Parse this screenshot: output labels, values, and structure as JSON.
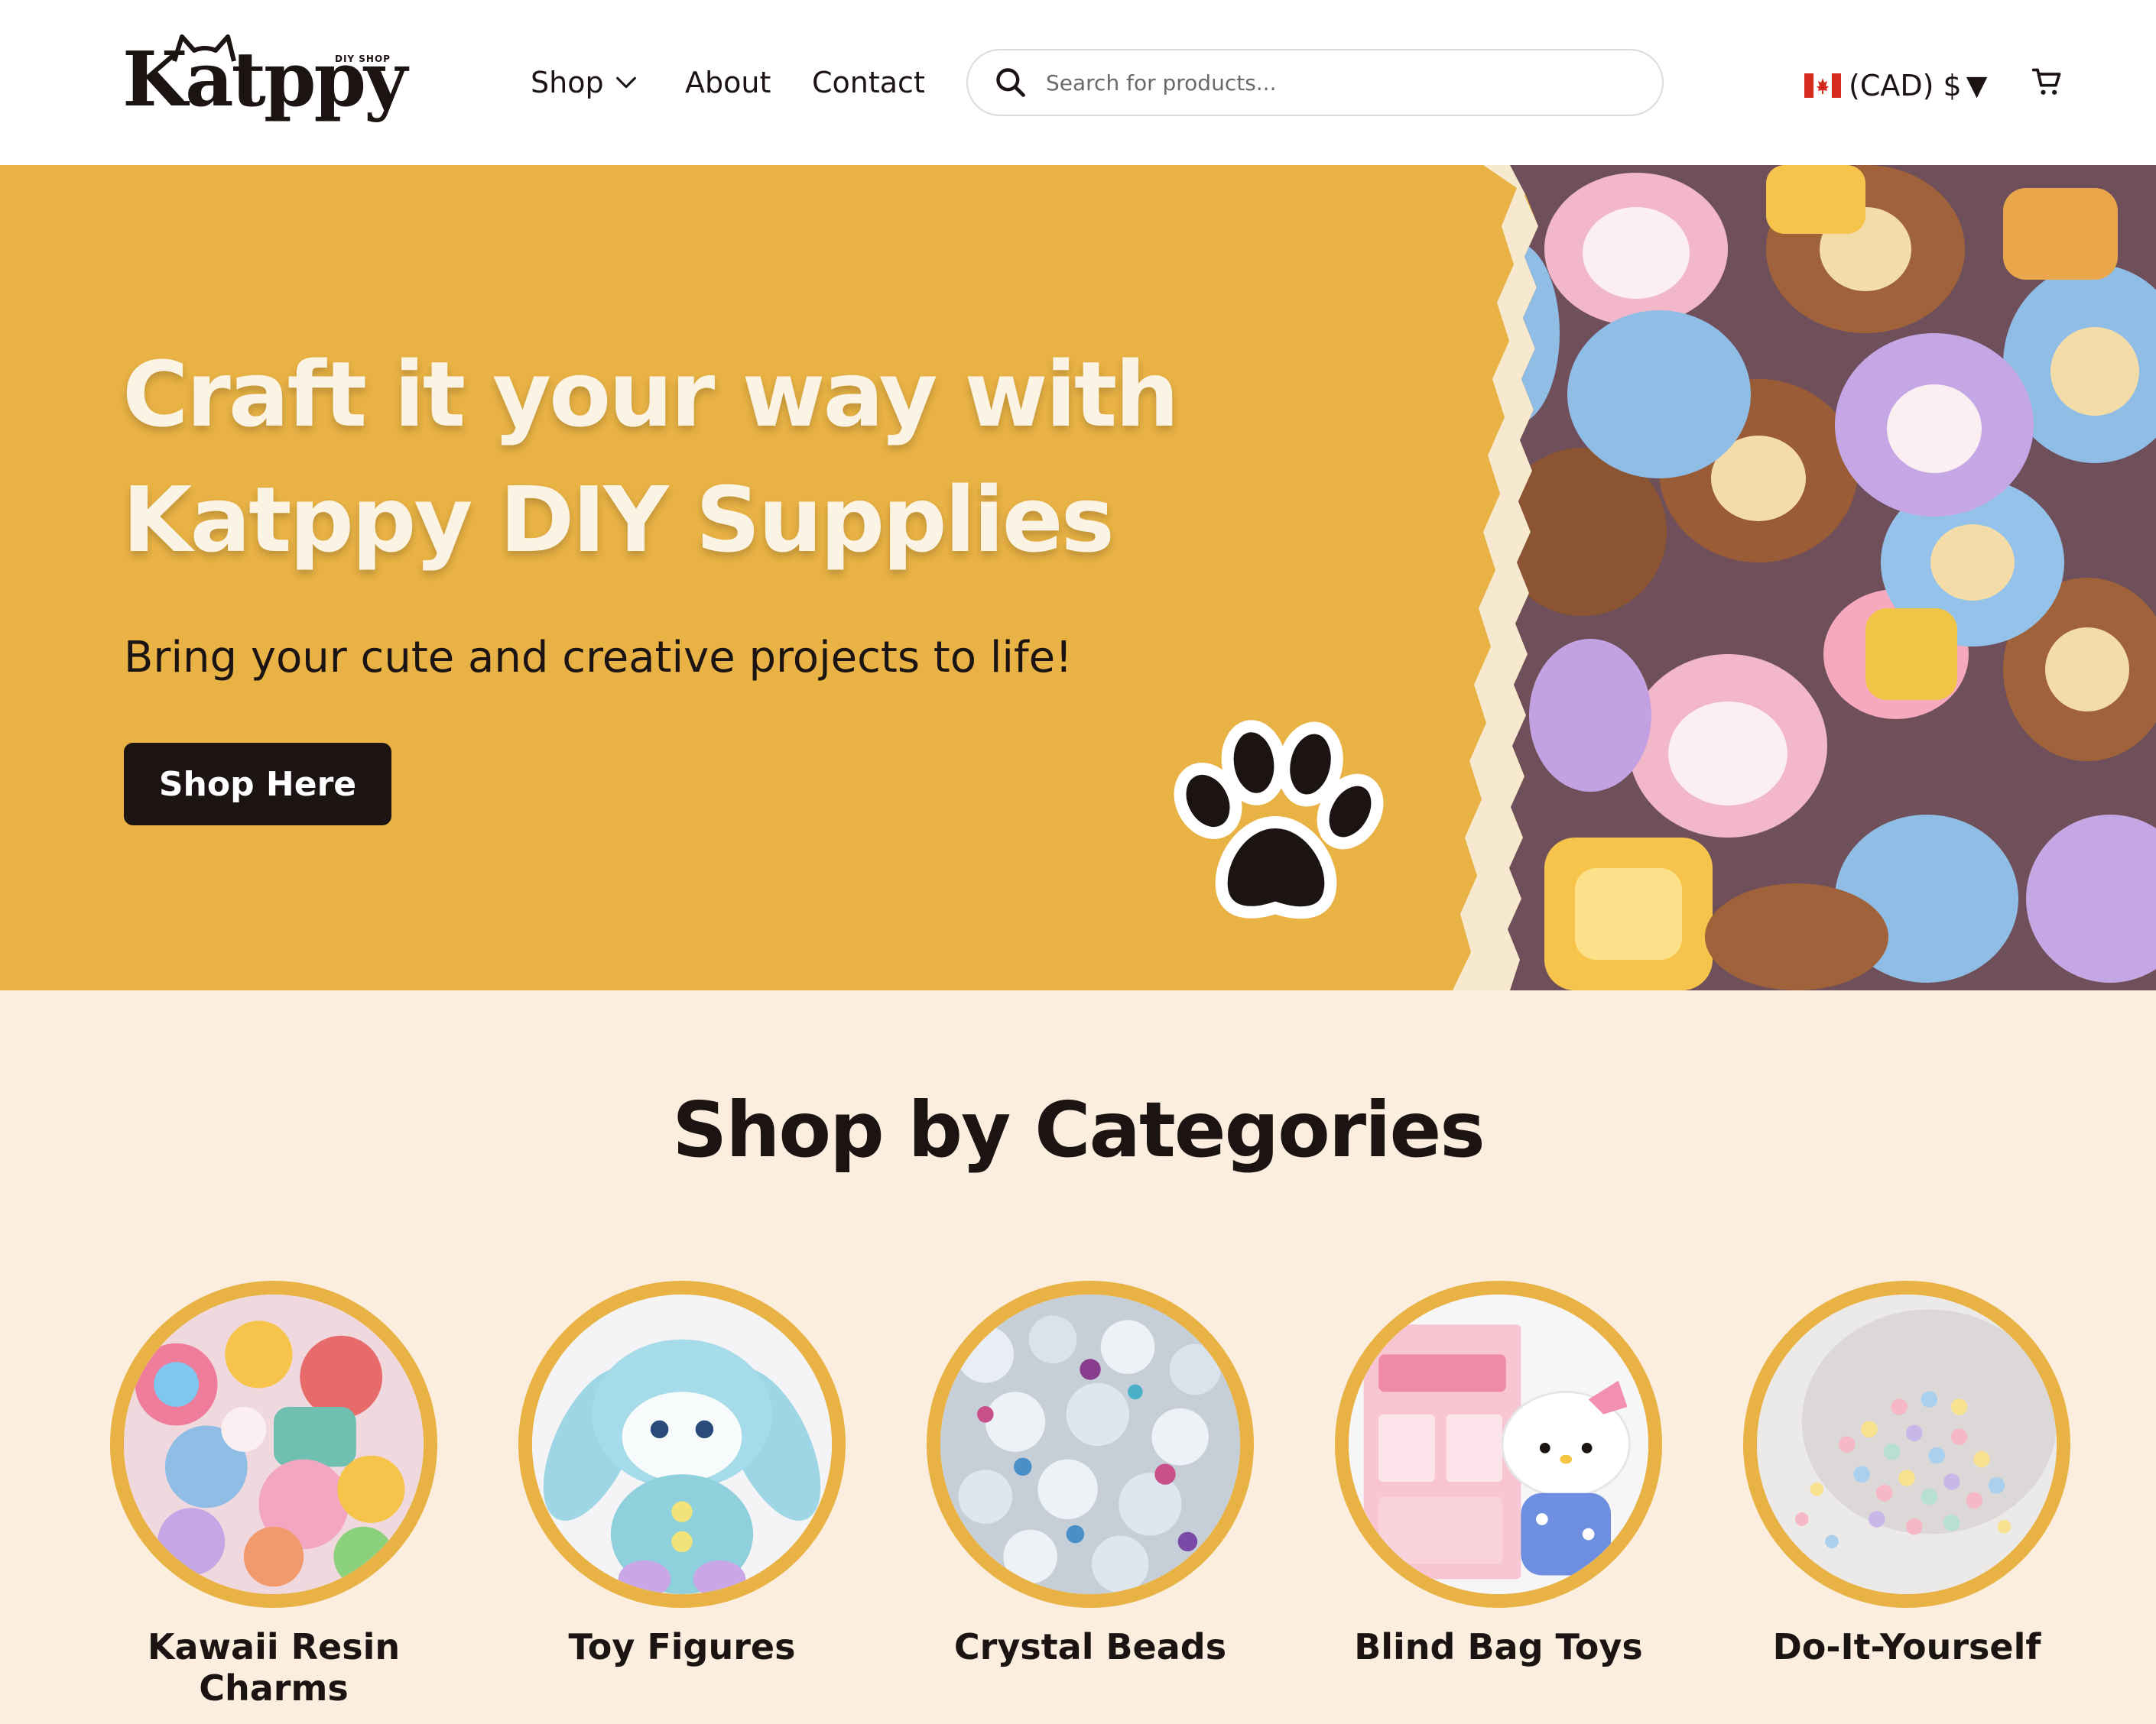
{
  "brand": {
    "name": "Katppy",
    "tagline": "DIY SHOP"
  },
  "nav": {
    "shop": "Shop",
    "about": "About",
    "contact": "Contact"
  },
  "search": {
    "placeholder": "Search for products..."
  },
  "currency": {
    "label": "(CAD) $",
    "caret": "▼",
    "flag": "canada-flag-icon"
  },
  "hero": {
    "title_line1": "Craft it your way with",
    "title_line2": "Katppy DIY Supplies",
    "subtitle": "Bring your cute and creative projects to life!",
    "button": "Shop Here"
  },
  "categories": {
    "title": "Shop by Categories",
    "items": [
      {
        "label_line1": "Kawaii Resin",
        "label_line2": "Charms"
      },
      {
        "label_line1": "Toy Figures",
        "label_line2": ""
      },
      {
        "label_line1": "Crystal Beads",
        "label_line2": ""
      },
      {
        "label_line1": "Blind Bag Toys",
        "label_line2": ""
      },
      {
        "label_line1": "Do-It-Yourself",
        "label_line2": ""
      }
    ]
  },
  "colors": {
    "accent": "#e8b244",
    "dark": "#1c1413",
    "cream": "#fbeede",
    "hero_text": "#fbf3e4"
  },
  "icons": [
    "chevron-down-icon",
    "search-icon",
    "canada-flag-icon",
    "cart-icon",
    "paw-icon",
    "cat-ears-icon"
  ]
}
